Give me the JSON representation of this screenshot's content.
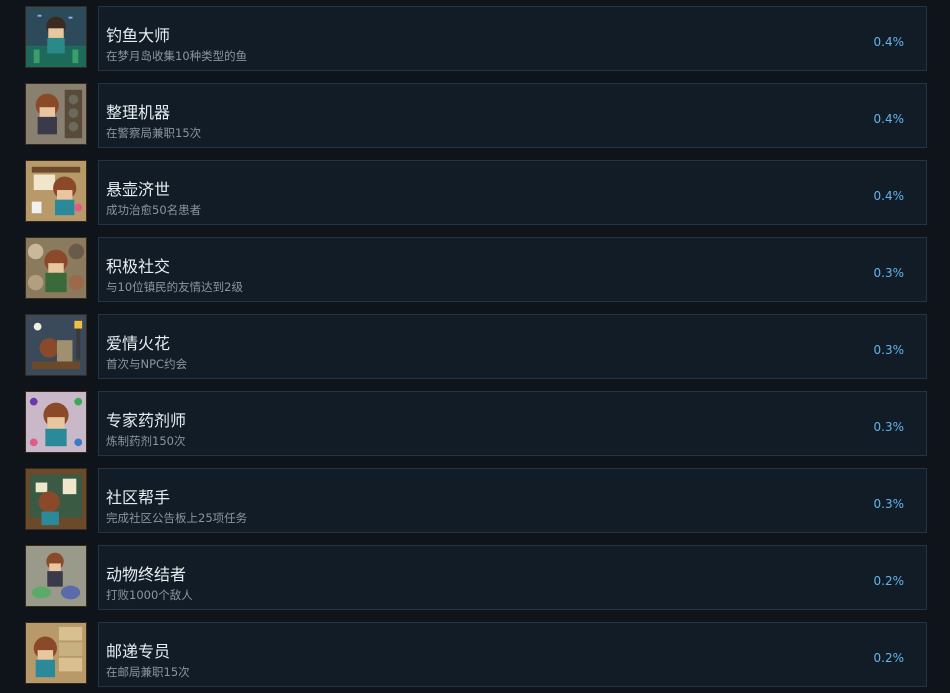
{
  "achievements": [
    {
      "title": "钓鱼大师",
      "description": "在梦月岛收集10种类型的鱼",
      "percent": "0.4%",
      "icon": "fishing-achievement-icon",
      "bg": "#2c4a5a"
    },
    {
      "title": "整理机器",
      "description": "在警察局兼职15次",
      "percent": "0.4%",
      "icon": "sorting-machine-achievement-icon",
      "bg": "#8a8070"
    },
    {
      "title": "悬壶济世",
      "description": "成功治愈50名患者",
      "percent": "0.4%",
      "icon": "healing-achievement-icon",
      "bg": "#b89a6a"
    },
    {
      "title": "积极社交",
      "description": "与10位镇民的友情达到2级",
      "percent": "0.3%",
      "icon": "social-achievement-icon",
      "bg": "#8a7a5e"
    },
    {
      "title": "爱情火花",
      "description": "首次与NPC约会",
      "percent": "0.3%",
      "icon": "date-achievement-icon",
      "bg": "#3a4a5a"
    },
    {
      "title": "专家药剂师",
      "description": "炼制药剂150次",
      "percent": "0.3%",
      "icon": "potion-achievement-icon",
      "bg": "#c9b8c8"
    },
    {
      "title": "社区帮手",
      "description": "完成社区公告板上25项任务",
      "percent": "0.3%",
      "icon": "bulletin-board-achievement-icon",
      "bg": "#3a5a44"
    },
    {
      "title": "动物终结者",
      "description": "打败1000个敌人",
      "percent": "0.2%",
      "icon": "monster-slayer-achievement-icon",
      "bg": "#9a9a8a"
    },
    {
      "title": "邮递专员",
      "description": "在邮局兼职15次",
      "percent": "0.2%",
      "icon": "post-office-achievement-icon",
      "bg": "#b89a6a"
    }
  ]
}
